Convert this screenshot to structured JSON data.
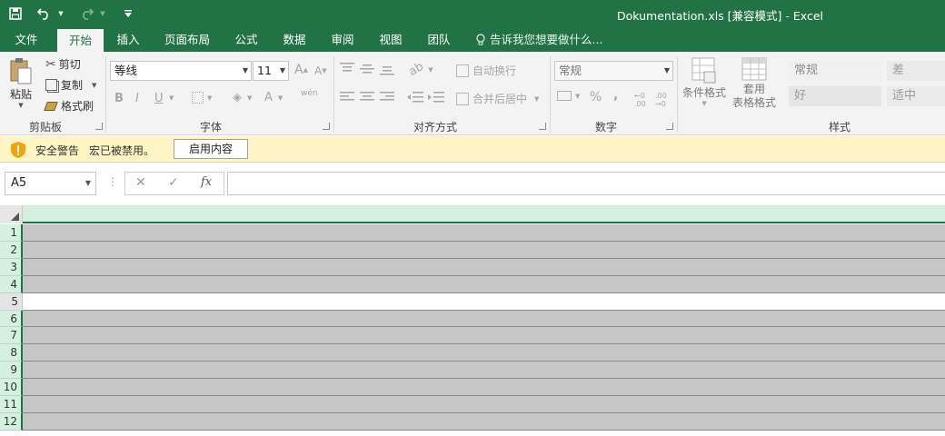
{
  "title_bar": {
    "title": "Dokumentation.xls  [兼容模式] - Excel",
    "quick_access": [
      "save-icon",
      "undo-icon",
      "redo-icon",
      "customize-icon"
    ]
  },
  "tabs": [
    {
      "label": "文件",
      "active": false
    },
    {
      "label": "开始",
      "active": true
    },
    {
      "label": "插入",
      "active": false
    },
    {
      "label": "页面布局",
      "active": false
    },
    {
      "label": "公式",
      "active": false
    },
    {
      "label": "数据",
      "active": false
    },
    {
      "label": "审阅",
      "active": false
    },
    {
      "label": "视图",
      "active": false
    },
    {
      "label": "团队",
      "active": false
    }
  ],
  "tell_me": "告诉我您想要做什么...",
  "ribbon": {
    "clipboard": {
      "paste": "粘贴",
      "cut": "剪切",
      "copy": "复制",
      "format_painter": "格式刷",
      "label": "剪贴板"
    },
    "font": {
      "font_name": "等线",
      "font_size": "11",
      "grow": "A",
      "shrink": "A",
      "bold": "B",
      "italic": "I",
      "underline": "U",
      "font_color": "A",
      "phonetic": "wén",
      "label": "字体"
    },
    "alignment": {
      "wrap_text": "自动换行",
      "merge_center": "合并后居中",
      "label": "对齐方式"
    },
    "number": {
      "format": "常规",
      "percent": "%",
      "comma": ",",
      "label": "数字"
    },
    "styles": {
      "conditional": "条件格式",
      "table_line1": "套用",
      "table_line2": "表格格式",
      "cells": [
        "常规",
        "差",
        "好",
        "适中"
      ],
      "label": "样式"
    }
  },
  "security_bar": {
    "title": "安全警告",
    "message": "宏已被禁用。",
    "button": "启用内容"
  },
  "formula_bar": {
    "name_box": "A5",
    "fx": "fx",
    "value": ""
  },
  "grid": {
    "rows": [
      "1",
      "2",
      "3",
      "4",
      "5",
      "6",
      "7",
      "8",
      "9",
      "10",
      "11",
      "12"
    ],
    "selected_row": "5"
  },
  "colors": {
    "accent": "#217346",
    "warning_bar": "#fff4c4",
    "disabled_cells": "#c6c6c6"
  }
}
